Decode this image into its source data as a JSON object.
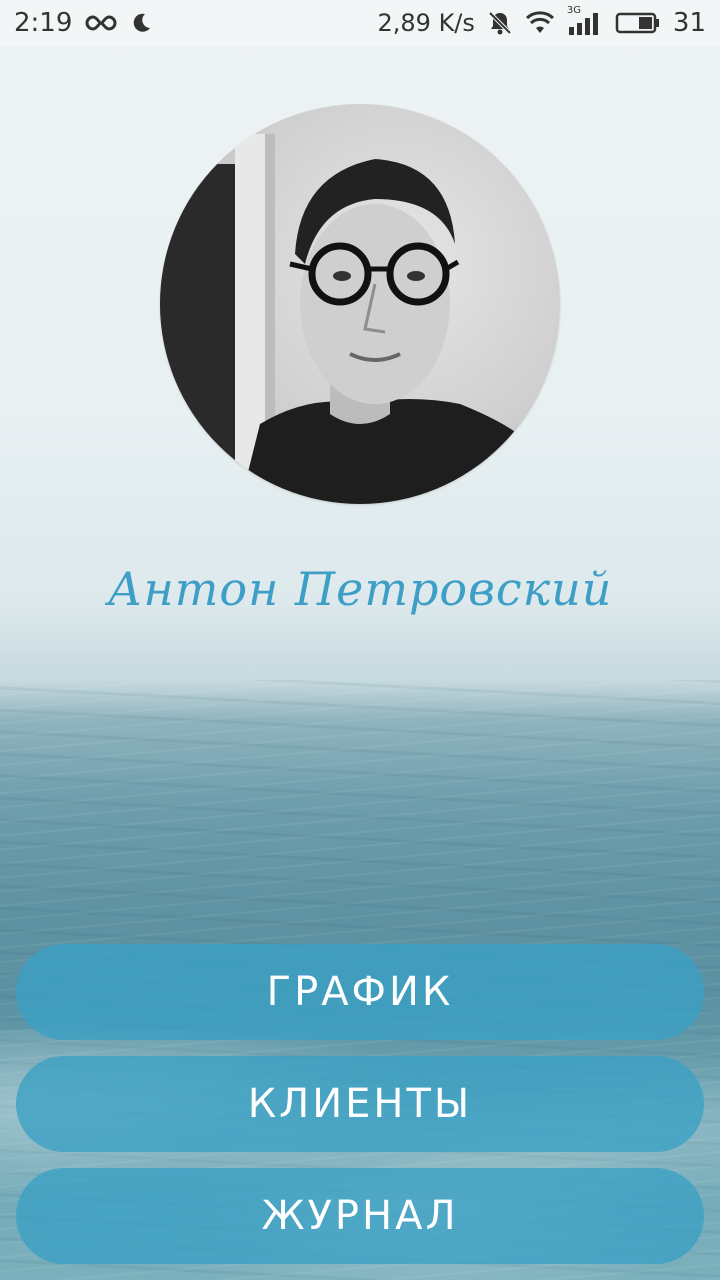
{
  "status_bar": {
    "time": "2:19",
    "speed": "2,89 K/s",
    "signal_label": "3G",
    "battery": "31",
    "icons": [
      "infinity-icon",
      "moon-icon",
      "bell-muted-icon",
      "wifi-icon",
      "signal-icon",
      "battery-icon"
    ]
  },
  "profile": {
    "name": "Антон Петровский",
    "avatar_icon": "profile-photo"
  },
  "menu": {
    "buttons": [
      {
        "label": "ГРАФИК"
      },
      {
        "label": "КЛИЕНТЫ"
      },
      {
        "label": "ЖУРНАЛ"
      }
    ]
  },
  "colors": {
    "accent": "#3d9ec6",
    "button_bg": "#3aa0c4",
    "button_text": "#ffffff"
  }
}
